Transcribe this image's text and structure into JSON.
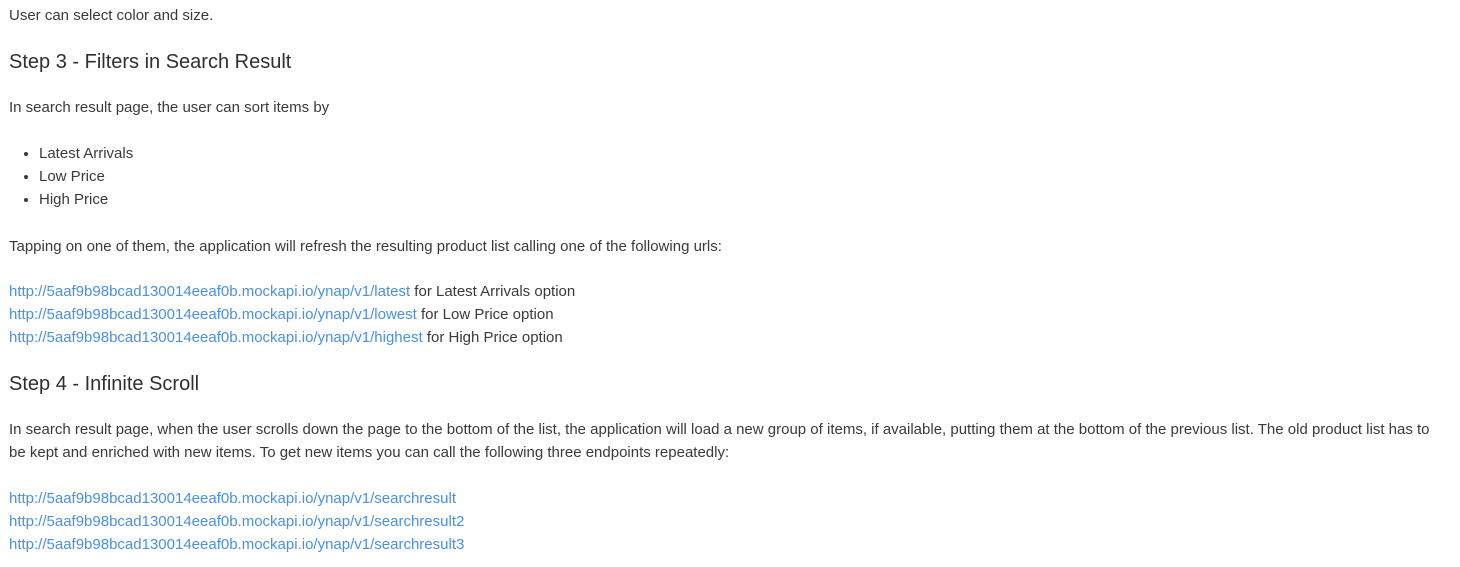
{
  "intro": "User can select color and size.",
  "step3": {
    "heading": "Step 3 - Filters in Search Result",
    "paragraph": "In search result page, the user can sort items by",
    "options": [
      "Latest Arrivals",
      "Low Price",
      "High Price"
    ],
    "tapping": "Tapping on one of them, the application will refresh the resulting product list calling one of the following urls:",
    "urls": [
      {
        "href": "http://5aaf9b98bcad130014eeaf0b.mockapi.io/ynap/v1/latest",
        "suffix": " for Latest Arrivals option"
      },
      {
        "href": "http://5aaf9b98bcad130014eeaf0b.mockapi.io/ynap/v1/lowest",
        "suffix": " for Low Price option"
      },
      {
        "href": "http://5aaf9b98bcad130014eeaf0b.mockapi.io/ynap/v1/highest",
        "suffix": " for High Price option"
      }
    ]
  },
  "step4": {
    "heading": "Step 4 - Infinite Scroll",
    "paragraph": "In search result page, when the user scrolls down the page to the bottom of the list, the application will load a new group of items, if available, putting them at the bottom of the previous list. The old product list has to be kept and enriched with new items. To get new items you can call the following three endpoints repeatedly:",
    "urls": [
      "http://5aaf9b98bcad130014eeaf0b.mockapi.io/ynap/v1/searchresult",
      "http://5aaf9b98bcad130014eeaf0b.mockapi.io/ynap/v1/searchresult2",
      "http://5aaf9b98bcad130014eeaf0b.mockapi.io/ynap/v1/searchresult3"
    ]
  },
  "colors": {
    "link": "#4a90e2",
    "text": "#3a3a3a"
  }
}
